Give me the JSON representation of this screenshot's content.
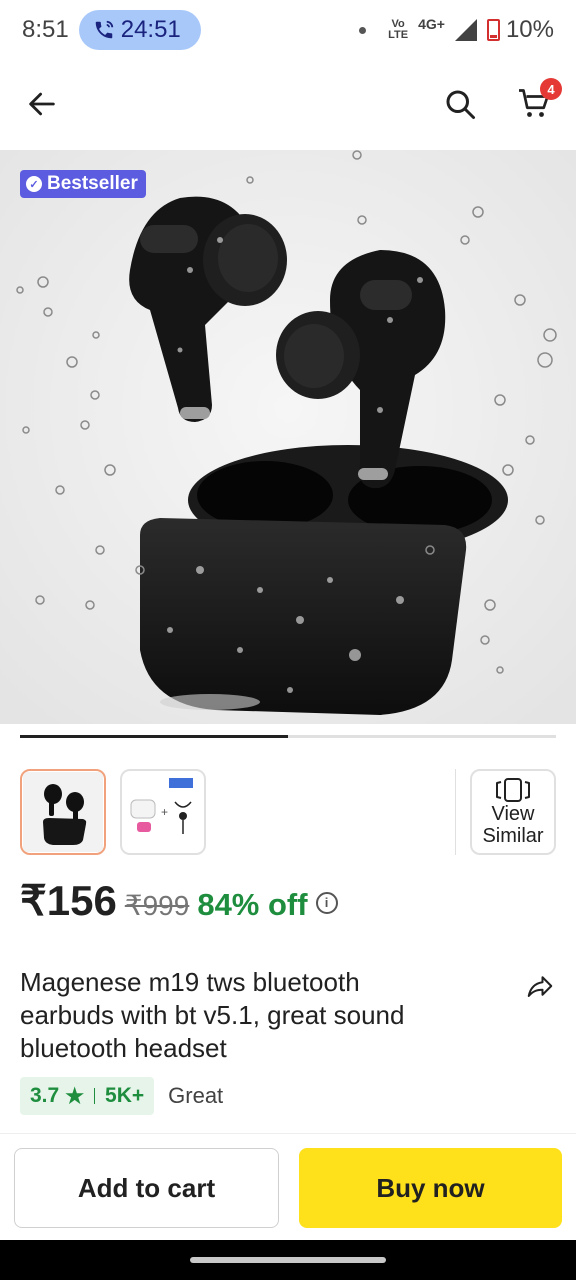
{
  "status_bar": {
    "time": "8:51",
    "call_timer": "24:51",
    "volte_line1": "Vo",
    "volte_line2": "LTE",
    "network": "4G+",
    "battery": "10%"
  },
  "app_bar": {
    "cart_count": "4",
    "icons": [
      "back-arrow-icon",
      "search-icon",
      "cart-icon"
    ]
  },
  "product": {
    "badge": "Bestseller",
    "gallery_progress": 0.5,
    "thumbnail_count": 2,
    "view_similar_line1": "View",
    "view_similar_line2": "Similar",
    "price": "₹156",
    "mrp": "₹999",
    "discount": "84% off",
    "title": "Magenese m19 tws bluetooth earbuds with bt v5.1, great sound bluetooth headset",
    "rating": "3.7",
    "rating_star": "★",
    "rating_count": "5K+",
    "rating_word": "Great"
  },
  "actions": {
    "add_to_cart": "Add to cart",
    "buy_now": "Buy now"
  },
  "colors": {
    "buy_now_bg": "#ffe11b",
    "discount_green": "#1e8e3e",
    "badge_purple": "#5b5ce0",
    "cart_badge_red": "#e53935"
  }
}
